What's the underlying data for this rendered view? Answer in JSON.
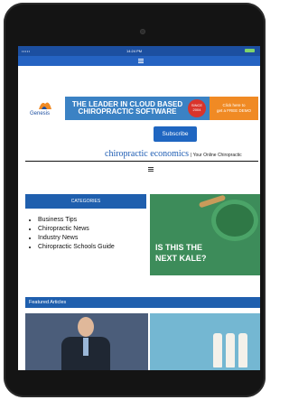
{
  "status_bar": {
    "signal": "•••••",
    "time": "14:24 PM"
  },
  "banner": {
    "logo_text": "Genesis",
    "headline_line1": "THE LEADER IN CLOUD BASED",
    "headline_line2": "CHIROPRACTIC SOFTWARE",
    "badge_line1": "SINCE",
    "badge_line2": "2004",
    "cta_line1": "Click here to",
    "cta_line2": "get a FREE DEMO"
  },
  "subscribe_label": "Subscribe",
  "brand": {
    "name": "chiropractic economics",
    "tagline": "| Your Online Chiropractic"
  },
  "categories": {
    "header": "CATEGORIES",
    "items": [
      "Business Tips",
      "Chiropractic News",
      "Industry News",
      "Chiropractic Schools Guide"
    ]
  },
  "ad": {
    "line1": "IS THIS THE",
    "line2": "NEXT KALE?"
  },
  "featured": {
    "header": "Featured Articles"
  },
  "colors": {
    "brand_blue": "#1f5fae",
    "status_bar": "#1c4fa0",
    "accent_orange": "#f08a24"
  }
}
